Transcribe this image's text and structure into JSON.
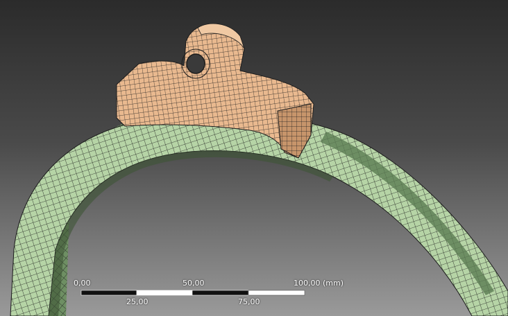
{
  "viewport": {
    "background_top": "#2b2b2b",
    "background_bottom": "#9a9a9a",
    "ring_color": "#b6d4a6",
    "ring_shade_color": "#5b7c52",
    "bracket_color": "#e9b98f",
    "bracket_shade_color": "#8a5e3e",
    "mesh_line_color": "#1c1c1c"
  },
  "scale": {
    "tick_top": [
      "0,00",
      "50,00",
      "100,00 (mm)"
    ],
    "tick_bottom": [
      "25,00",
      "75,00"
    ],
    "bar_dark": "#111111",
    "bar_light": "#ffffff"
  }
}
